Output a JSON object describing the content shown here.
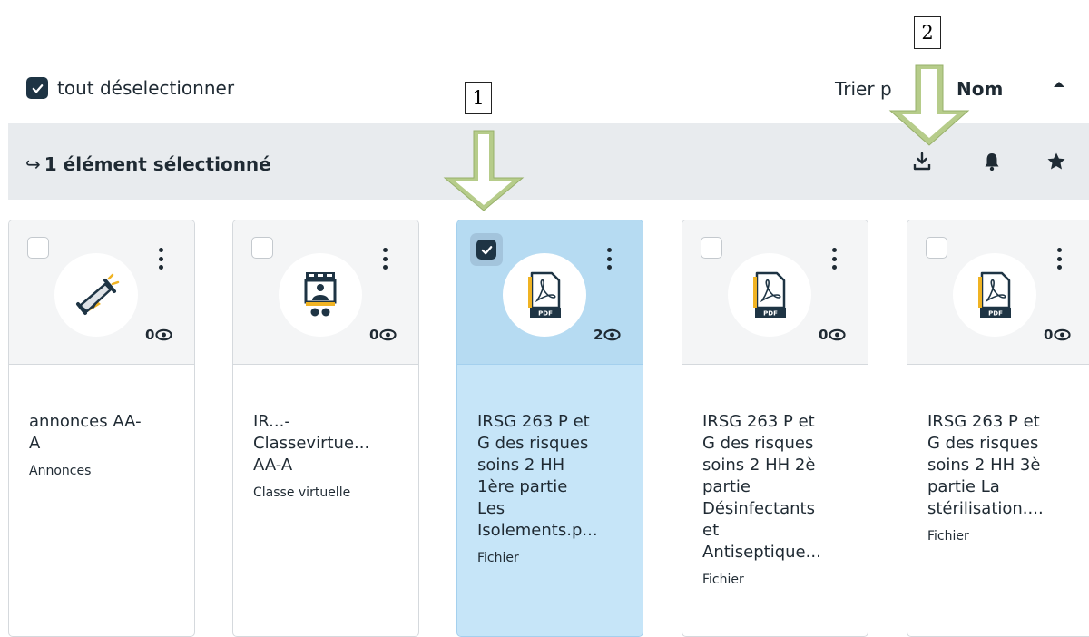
{
  "toolbar": {
    "select_all_label": "tout déselectionner",
    "sort_prefix": "Trier p",
    "sort_value": "Nom"
  },
  "selection_bar": {
    "arrow_glyph": "↪",
    "text": "1 élément sélectionné",
    "actions": [
      "download-icon",
      "bell-icon",
      "star-icon"
    ]
  },
  "cards": [
    {
      "title": "annonces AA-\nA",
      "type": "Annonces",
      "views": "0",
      "icon": "megaphone-icon",
      "selected": false
    },
    {
      "title": "IR...-\nClassevirtue...\nAA-A",
      "type": "Classe virtuelle",
      "views": "0",
      "icon": "virtual-class-icon",
      "selected": false
    },
    {
      "title": "IRSG 263 P et\nG des risques\nsoins 2 HH\n1ère partie\nLes\nIsolements.p...",
      "type": "Fichier",
      "views": "2",
      "icon": "pdf-icon",
      "selected": true
    },
    {
      "title": "IRSG 263 P et\nG des risques\nsoins 2 HH 2è\npartie\nDésinfectants\net\nAntiseptique...",
      "type": "Fichier",
      "views": "0",
      "icon": "pdf-icon",
      "selected": false
    },
    {
      "title": "IRSG 263 P et\nG des risques\nsoins 2 HH 3è\npartie La\nstérilisation....",
      "type": "Fichier",
      "views": "0",
      "icon": "pdf-icon",
      "selected": false
    }
  ],
  "annotations": {
    "label_1": "1",
    "label_2": "2"
  },
  "colors": {
    "accent_dark": "#1e3444",
    "selected_card": "#c6e5f8",
    "arrow_green": "#b6cc8a",
    "pdf_gold": "#f0b323"
  }
}
